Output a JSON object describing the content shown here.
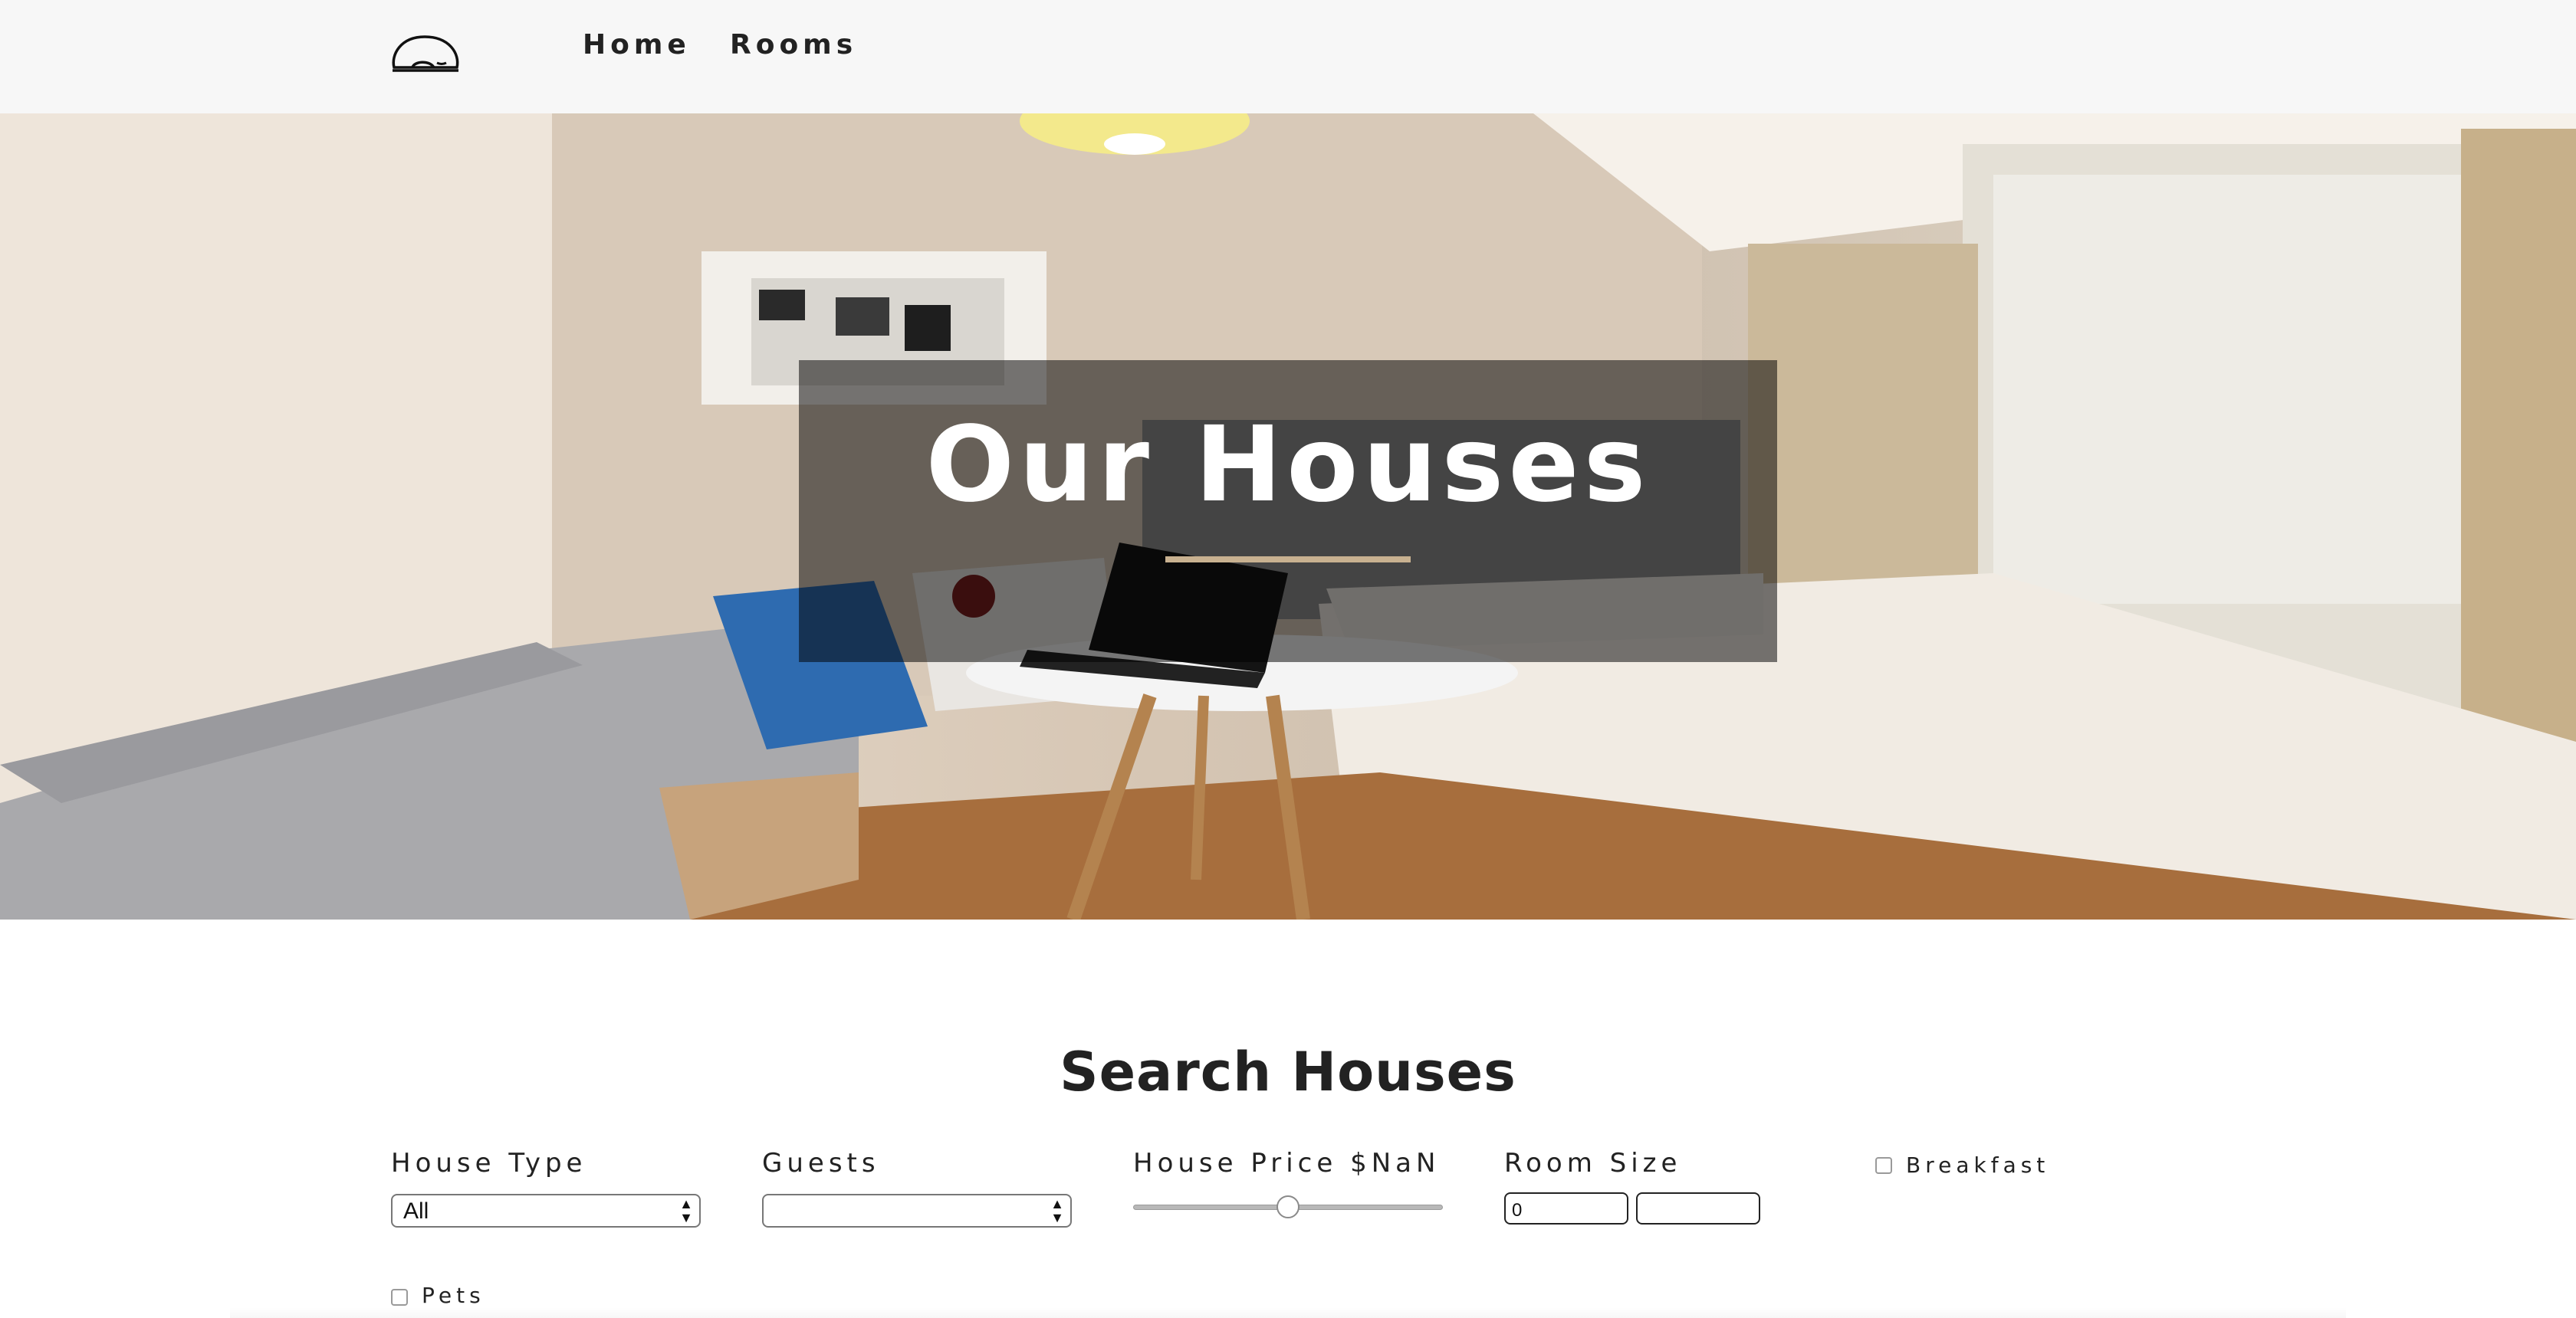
{
  "nav": {
    "logo_icon": "bean-bed-logo-icon",
    "links": [
      {
        "label": "Home"
      },
      {
        "label": "Rooms"
      }
    ]
  },
  "hero": {
    "title": "Our Houses",
    "image": "bedroom-interior-photo",
    "accent_color": "#c8b190"
  },
  "search": {
    "title": "Search Houses",
    "house_type": {
      "label": "House Type",
      "selected": "All"
    },
    "guests": {
      "label": "Guests",
      "selected": ""
    },
    "price": {
      "label": "House Price $NaN",
      "value_fraction": 0.5
    },
    "room_size": {
      "label": "Room Size",
      "min_value": "0",
      "max_value": ""
    },
    "breakfast": {
      "label": "Breakfast",
      "checked": false
    },
    "pets": {
      "label": "Pets",
      "checked": false
    }
  }
}
